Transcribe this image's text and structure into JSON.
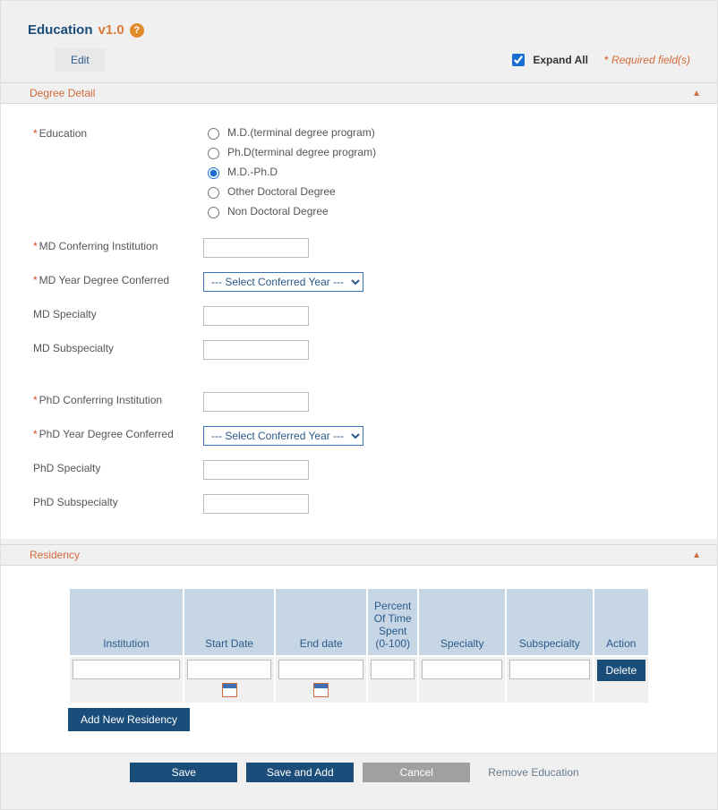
{
  "header": {
    "title": "Education",
    "version": "v1.0",
    "editLabel": "Edit",
    "expandAllLabel": "Expand All",
    "expandAllChecked": true,
    "requiredPrefix": "* ",
    "requiredText": "Required field(s)"
  },
  "sections": {
    "degree": {
      "title": "Degree Detail",
      "fields": {
        "education": {
          "label": "Education",
          "required": true,
          "options": [
            "M.D.(terminal degree program)",
            "Ph.D(terminal degree program)",
            "M.D.-Ph.D",
            "Other Doctoral Degree",
            "Non Doctoral Degree"
          ],
          "selected": 2
        },
        "mdInst": {
          "label": "MD Conferring Institution",
          "required": true,
          "value": ""
        },
        "mdYear": {
          "label": "MD Year Degree Conferred",
          "required": true,
          "placeholder": "--- Select Conferred Year ---",
          "value": ""
        },
        "mdSpec": {
          "label": "MD Specialty",
          "required": false,
          "value": ""
        },
        "mdSub": {
          "label": "MD Subspecialty",
          "required": false,
          "value": ""
        },
        "phdInst": {
          "label": "PhD Conferring Institution",
          "required": true,
          "value": ""
        },
        "phdYear": {
          "label": "PhD Year Degree Conferred",
          "required": true,
          "placeholder": "--- Select Conferred Year ---",
          "value": ""
        },
        "phdSpec": {
          "label": "PhD Specialty",
          "required": false,
          "value": ""
        },
        "phdSub": {
          "label": "PhD Subspecialty",
          "required": false,
          "value": ""
        }
      }
    },
    "residency": {
      "title": "Residency",
      "columns": {
        "inst": "Institution",
        "start": "Start Date",
        "end": "End date",
        "pct": "Percent Of Time Spent (0-100)",
        "spec": "Specialty",
        "sub": "Subspecialty",
        "action": "Action"
      },
      "row": {
        "inst": "",
        "start": "",
        "end": "",
        "pct": "",
        "spec": "",
        "sub": ""
      },
      "deleteLabel": "Delete",
      "addLabel": "Add New Residency"
    }
  },
  "footer": {
    "save": "Save",
    "saveAdd": "Save and Add",
    "cancel": "Cancel",
    "remove": "Remove Education"
  }
}
